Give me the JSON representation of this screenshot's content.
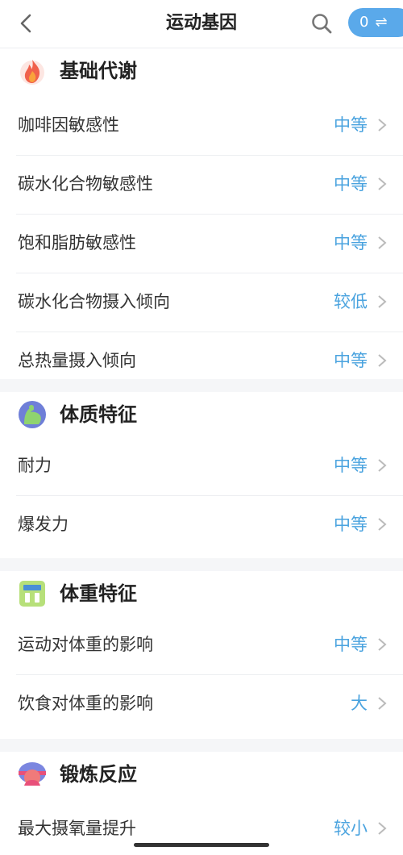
{
  "nav": {
    "back_icon": "chevron-left-icon",
    "title": "运动基因",
    "search_icon": "search-icon",
    "compare_count": "0",
    "compare_icon": "swap-arrows-icon"
  },
  "sections": [
    {
      "title": "基础代谢",
      "icon": "flame-icon",
      "items": [
        {
          "name": "咖啡因敏感性",
          "level": "中等"
        },
        {
          "name": "碳水化合物敏感性",
          "level": "中等"
        },
        {
          "name": "饱和脂肪敏感性",
          "level": "中等"
        },
        {
          "name": "碳水化合物摄入倾向",
          "level": "较低"
        },
        {
          "name": "总热量摄入倾向",
          "level": "中等"
        }
      ]
    },
    {
      "title": "体质特征",
      "icon": "flexed-arm-icon",
      "items": [
        {
          "name": "耐力",
          "level": "中等"
        },
        {
          "name": "爆发力",
          "level": "中等"
        }
      ]
    },
    {
      "title": "体重特征",
      "icon": "scale-icon",
      "items": [
        {
          "name": "运动对体重的影响",
          "level": "中等"
        },
        {
          "name": "饮食对体重的影响",
          "level": "大"
        }
      ]
    },
    {
      "title": "锻炼反应",
      "icon": "running-person-icon",
      "items": [
        {
          "name": "最大摄氧量提升",
          "level": "较小"
        }
      ]
    }
  ],
  "colors": {
    "accent": "#4aa3df",
    "pill": "#5aa9ea",
    "background": "#f5f6f8"
  }
}
